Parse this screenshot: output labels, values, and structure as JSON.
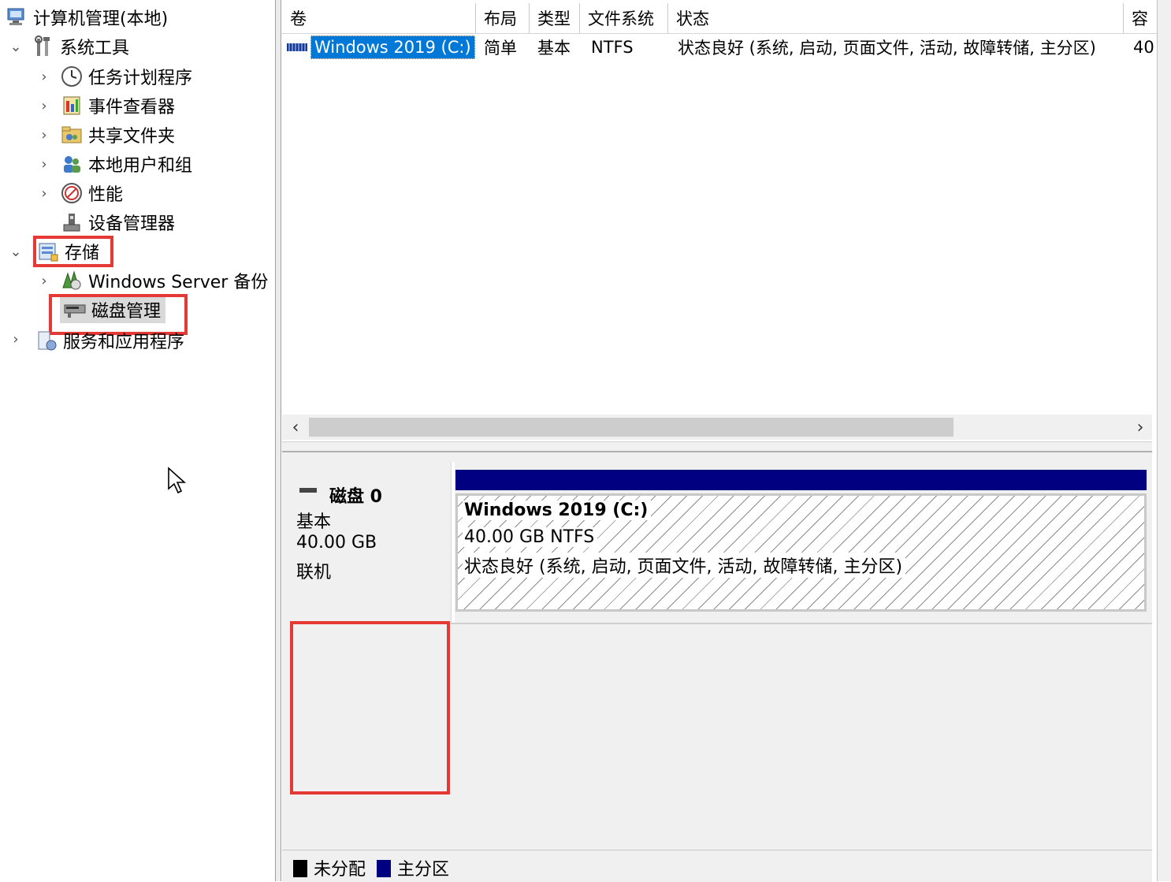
{
  "tree": {
    "root": "计算机管理(本地)",
    "system_tools": "系统工具",
    "task_scheduler": "任务计划程序",
    "event_viewer": "事件查看器",
    "shared_folders": "共享文件夹",
    "local_users_groups": "本地用户和组",
    "performance": "性能",
    "device_manager": "设备管理器",
    "storage": "存储",
    "windows_server_backup": "Windows Server 备份",
    "disk_management": "磁盘管理",
    "services_apps": "服务和应用程序"
  },
  "volume_list": {
    "columns": [
      "卷",
      "布局",
      "类型",
      "文件系统",
      "状态",
      "容"
    ],
    "rows": [
      {
        "volume": "Windows 2019 (C:)",
        "layout": "简单",
        "type": "基本",
        "filesystem": "NTFS",
        "status": "状态良好 (系统, 启动, 页面文件, 活动, 故障转储, 主分区)",
        "capacity": "40"
      }
    ]
  },
  "disk": {
    "name": "磁盘 0",
    "type": "基本",
    "size": "40.00 GB",
    "state": "联机",
    "partition": {
      "title": "Windows 2019  (C:)",
      "size_fs": "40.00 GB NTFS",
      "status": "状态良好 (系统, 启动, 页面文件, 活动, 故障转储, 主分区)"
    }
  },
  "legend": {
    "unallocated": "未分配",
    "primary": "主分区"
  },
  "colors": {
    "primary_partition": "#000080",
    "unallocated": "#000000",
    "selection": "#0078d7",
    "highlight_box": "#e53935"
  }
}
